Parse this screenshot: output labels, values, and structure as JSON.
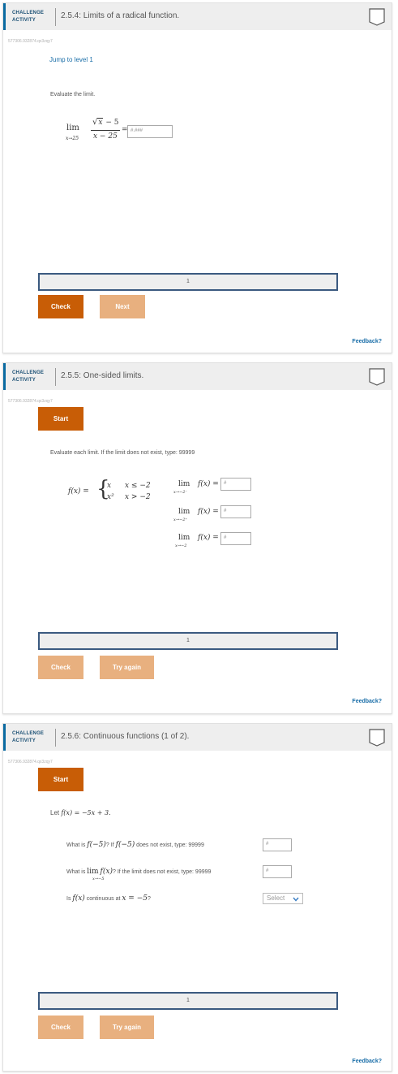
{
  "activities": [
    {
      "badge_line1": "CHALLENGE",
      "badge_line2": "ACTIVITY",
      "title": "2.5.4: Limits of a radical function.",
      "id": "577306.932874.qx3zqy7",
      "jump_link": "Jump to level 1",
      "instruction": "Evaluate the limit.",
      "math": {
        "lim": "lim",
        "sub": "x→25",
        "num_sqrt": "x",
        "num_rest": " − 5",
        "den": "x − 25",
        "eq": "="
      },
      "answer_placeholder": "#.###",
      "level": "1",
      "buttons": [
        "Check",
        "Next"
      ],
      "feedback": "Feedback?"
    },
    {
      "badge_line1": "CHALLENGE",
      "badge_line2": "ACTIVITY",
      "title": "2.5.5: One-sided limits.",
      "id": "577306.932874.qx3zqy7",
      "start": "Start",
      "instruction": "Evaluate each limit. If the limit does not exist, type: 99999",
      "piece": {
        "lhs": "f(x) =",
        "case1_expr": "x",
        "case1_cond": "x ≤ −2",
        "case2_expr": "x²",
        "case2_cond": "x > −2"
      },
      "limits": [
        {
          "lim": "lim",
          "sub": "x→−2⁻",
          "fx": "f(x) =",
          "ph": "#"
        },
        {
          "lim": "lim",
          "sub": "x→−2⁺",
          "fx": "f(x) =",
          "ph": "#"
        },
        {
          "lim": "lim",
          "sub": "x→−2",
          "fx": "f(x) =",
          "ph": "#"
        }
      ],
      "level": "1",
      "buttons": [
        "Check",
        "Try again"
      ],
      "feedback": "Feedback?"
    },
    {
      "badge_line1": "CHALLENGE",
      "badge_line2": "ACTIVITY",
      "title": "2.5.6: Continuous functions (1 of 2).",
      "id": "577306.932874.qx3zqy7",
      "start": "Start",
      "let_text": "Let ",
      "let_math": "f(x) = −5x + 3.",
      "q1_a": "What is ",
      "q1_m1": "f(−5)",
      "q1_b": "? If ",
      "q1_m2": "f(−5)",
      "q1_c": " does not exist, type: 99999",
      "q1_ph": "#",
      "q2_a": "What is ",
      "q2_lim": "lim",
      "q2_sub": "x→−5",
      "q2_fx": "f(x)",
      "q2_b": "? If the limit does not exist, type: 99999",
      "q2_ph": "#",
      "q3_a": "Is ",
      "q3_m1": "f(x)",
      "q3_b": " continuous at ",
      "q3_m2": "x = −5",
      "q3_c": "?",
      "select_label": "Select",
      "level": "1",
      "buttons": [
        "Check",
        "Try again"
      ],
      "feedback": "Feedback?"
    }
  ]
}
